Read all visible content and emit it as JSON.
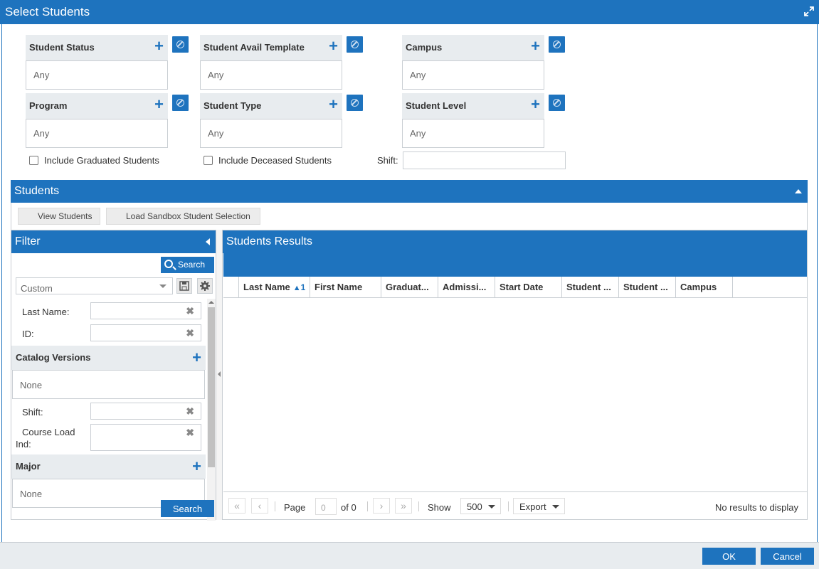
{
  "window": {
    "title": "Select Students"
  },
  "criteria": [
    {
      "label": "Student Status",
      "value": "Any"
    },
    {
      "label": "Student Avail Template",
      "value": "Any"
    },
    {
      "label": "Campus",
      "value": "Any"
    },
    {
      "label": "Program",
      "value": "Any"
    },
    {
      "label": "Student Type",
      "value": "Any"
    },
    {
      "label": "Student Level",
      "value": "Any"
    }
  ],
  "options": {
    "include_graduated": "Include Graduated Students",
    "include_deceased": "Include Deceased Students",
    "shift_label": "Shift:",
    "shift_value": ""
  },
  "students": {
    "title": "Students",
    "view_button": "View Students",
    "load_button": "Load Sandbox Student Selection"
  },
  "filter": {
    "title": "Filter",
    "search_label": "Search",
    "preset": "Custom",
    "fields": {
      "last_name": "Last Name:",
      "id": "ID:",
      "shift": "Shift:",
      "course_load": "Course Load",
      "course_load_2": "Ind:"
    },
    "catalog_versions": {
      "label": "Catalog Versions",
      "value": "None"
    },
    "major": {
      "label": "Major",
      "value": "None"
    },
    "search_bottom": "Search"
  },
  "results": {
    "title": "Students Results",
    "columns": [
      "Last Name",
      "First Name",
      "Graduat...",
      "Admissi...",
      "Start Date",
      "Student ...",
      "Student ...",
      "Campus"
    ],
    "sort_indicator": "1",
    "rows": []
  },
  "pager": {
    "page_label": "Page",
    "page_value": "0",
    "of_label": "of 0",
    "show_label": "Show",
    "page_size": "500",
    "export_label": "Export",
    "status": "No results to display"
  },
  "footer": {
    "ok": "OK",
    "cancel": "Cancel"
  },
  "colors": {
    "accent": "#1e73be",
    "panel_header": "#e8ecef"
  }
}
